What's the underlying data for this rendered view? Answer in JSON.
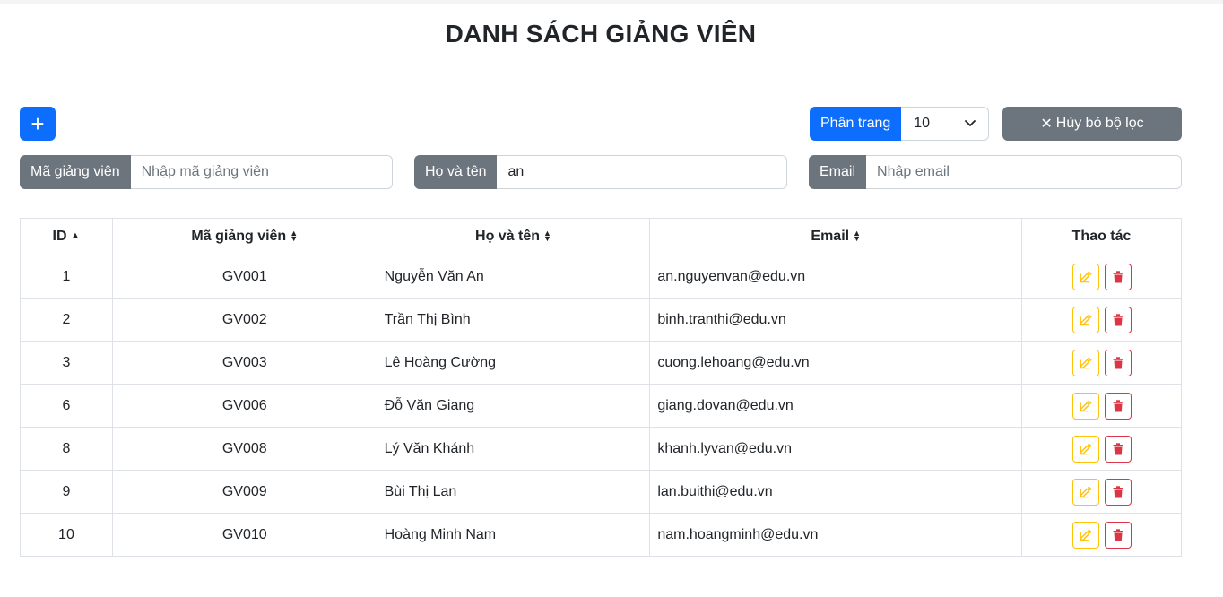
{
  "page": {
    "title": "DANH SÁCH GIẢNG VIÊN"
  },
  "toolbar": {
    "add_label": "+",
    "paging_label": "Phân trang",
    "paging_value": "10",
    "reset_label": "Hủy bỏ bộ lọc",
    "reset_icon": "✕"
  },
  "filters": {
    "code": {
      "label": "Mã giảng viên",
      "value": "",
      "placeholder": "Nhập mã giảng viên"
    },
    "name": {
      "label": "Họ và tên",
      "value": "an",
      "placeholder": ""
    },
    "email": {
      "label": "Email",
      "value": "",
      "placeholder": "Nhập email"
    }
  },
  "table": {
    "headers": {
      "id": "ID",
      "code": "Mã giảng viên",
      "name": "Họ và tên",
      "email": "Email",
      "actions": "Thao tác"
    },
    "rows": [
      {
        "id": "1",
        "code": "GV001",
        "name": "Nguyễn Văn An",
        "email": "an.nguyenvan@edu.vn"
      },
      {
        "id": "2",
        "code": "GV002",
        "name": "Trần Thị Bình",
        "email": "binh.tranthi@edu.vn"
      },
      {
        "id": "3",
        "code": "GV003",
        "name": "Lê Hoàng Cường",
        "email": "cuong.lehoang@edu.vn"
      },
      {
        "id": "6",
        "code": "GV006",
        "name": "Đỗ Văn Giang",
        "email": "giang.dovan@edu.vn"
      },
      {
        "id": "8",
        "code": "GV008",
        "name": "Lý Văn Khánh",
        "email": "khanh.lyvan@edu.vn"
      },
      {
        "id": "9",
        "code": "GV009",
        "name": "Bùi Thị Lan",
        "email": "lan.buithi@edu.vn"
      },
      {
        "id": "10",
        "code": "GV010",
        "name": "Hoàng Minh Nam",
        "email": "nam.hoangminh@edu.vn"
      }
    ]
  },
  "colors": {
    "primary": "#0d6efd",
    "secondary": "#6c757d",
    "warning": "#ffc107",
    "danger": "#dc3545"
  },
  "icons": {
    "add": "plus-icon",
    "reset": "x-icon",
    "edit": "edit-icon",
    "delete": "trash-icon",
    "sort_asc": "sort-up-icon",
    "sort": "sort-icon",
    "dropdown": "chevron-down-icon"
  }
}
